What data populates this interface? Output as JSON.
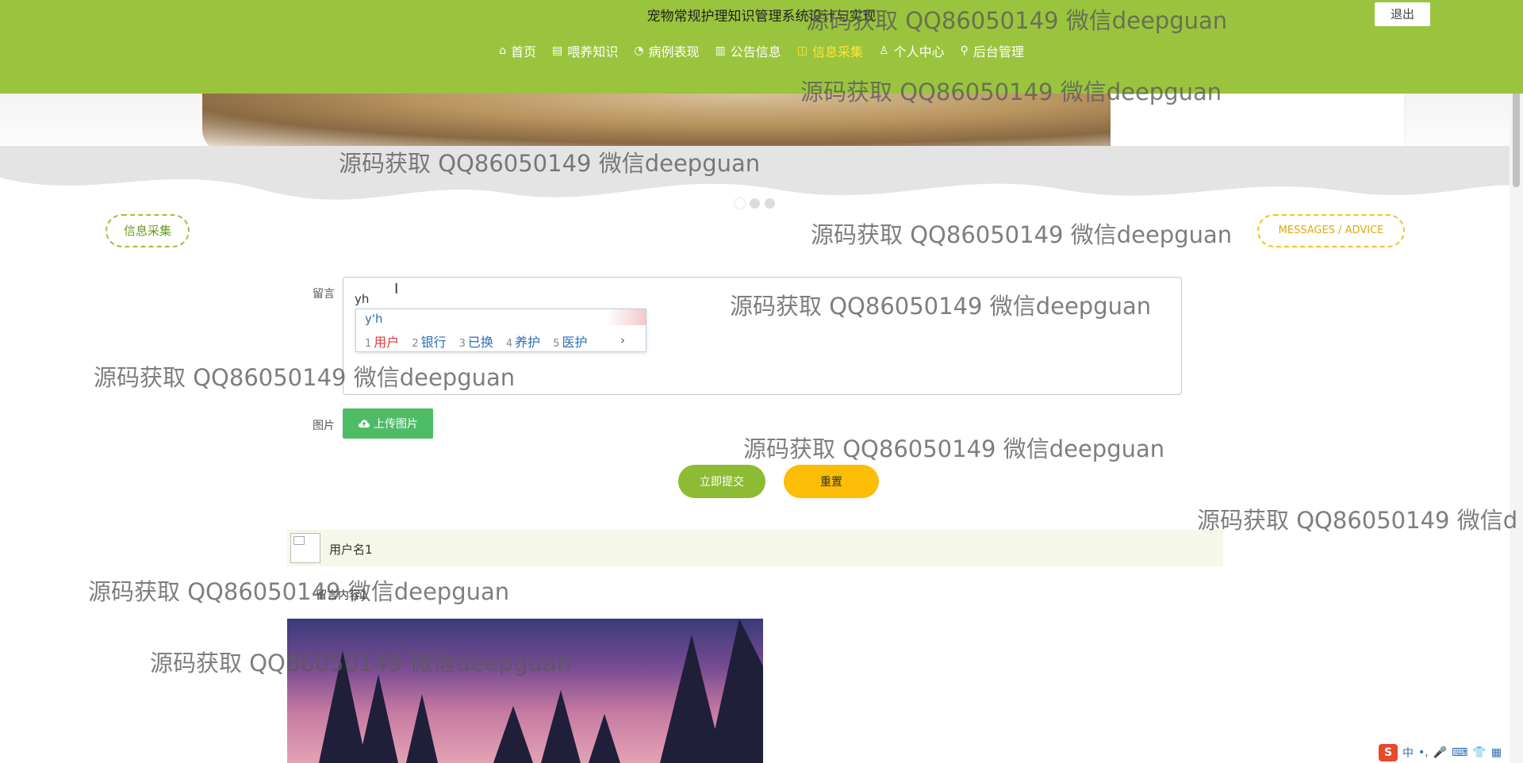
{
  "header": {
    "site_title": "宠物常规护理知识管理系统设计与实现",
    "logout_label": "退出",
    "nav": [
      {
        "label": "首页",
        "icon": "home-icon"
      },
      {
        "label": "喂养知识",
        "icon": "book-icon"
      },
      {
        "label": "病例表现",
        "icon": "paw-icon"
      },
      {
        "label": "公告信息",
        "icon": "document-icon"
      },
      {
        "label": "信息采集",
        "icon": "collect-icon",
        "active": true
      },
      {
        "label": "个人中心",
        "icon": "user-icon"
      },
      {
        "label": "后台管理",
        "icon": "link-icon"
      }
    ]
  },
  "carousel": {
    "slides": 3,
    "active_index": 1
  },
  "section": {
    "title": "信息采集",
    "subtitle": "MESSAGES / ADVICE"
  },
  "form": {
    "message_label": "留言",
    "message_value": "yh",
    "image_label": "图片",
    "upload_label": "上传图片",
    "submit_label": "立即提交",
    "reset_label": "重置"
  },
  "ime": {
    "composition": "y'h",
    "candidates": [
      {
        "num": "1",
        "text": "用户"
      },
      {
        "num": "2",
        "text": "银行"
      },
      {
        "num": "3",
        "text": "已换"
      },
      {
        "num": "4",
        "text": "养护"
      },
      {
        "num": "5",
        "text": "医护"
      }
    ],
    "next_label": "›",
    "tray": [
      "中",
      "•,",
      "🎤",
      "⌨",
      "👕",
      "▦"
    ]
  },
  "comment": {
    "username": "用户名1",
    "content": "留言内容1"
  },
  "watermark_text": "源码获取 QQ86050149 微信deepguan",
  "watermark_partial": "源码获取 QQ86050149 微信d"
}
